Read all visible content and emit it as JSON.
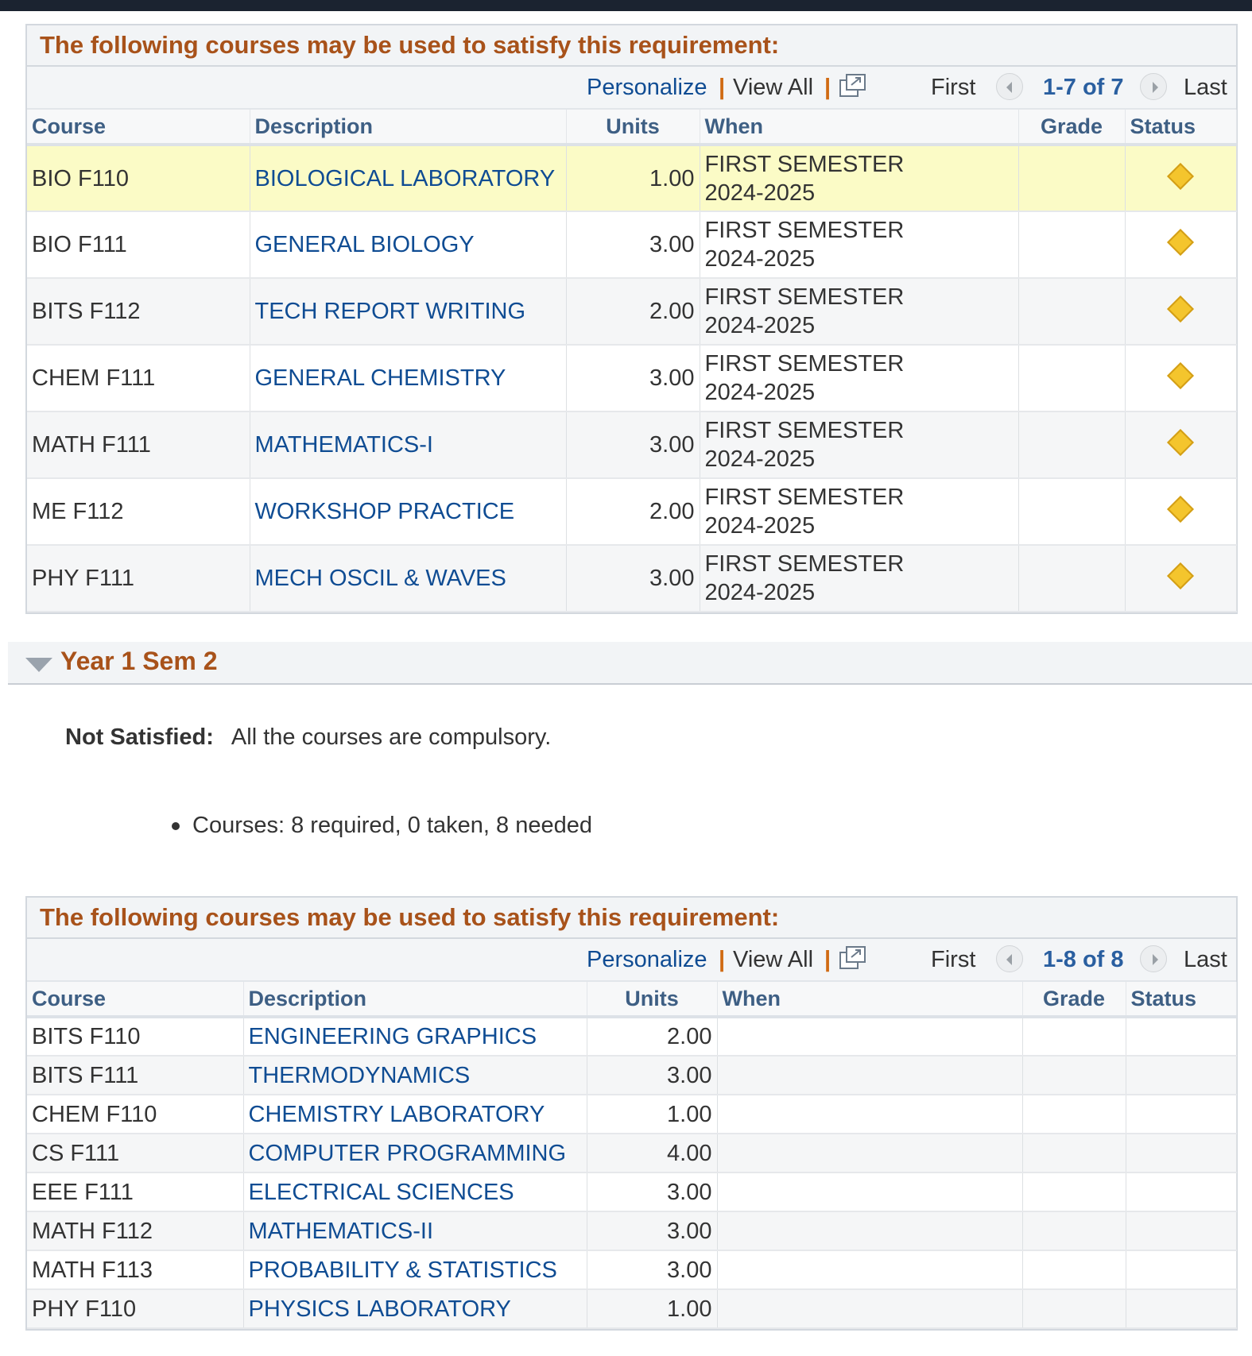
{
  "grid1": {
    "title": "The following courses may be used to satisfy this requirement:",
    "nav": {
      "personalize": "Personalize",
      "separator": "|",
      "view_all": "View All",
      "first": "First",
      "count": "1-7 of 7",
      "last": "Last",
      "popout_icon": "popout-window-icon",
      "prev_icon": "arrow-left-icon",
      "next_icon": "arrow-right-icon"
    },
    "headers": {
      "course": "Course",
      "description": "Description",
      "units": "Units",
      "when": "When",
      "grade": "Grade",
      "status": "Status"
    },
    "rows": [
      {
        "course": "BIO F110",
        "description": "BIOLOGICAL LABORATORY",
        "units": "1.00",
        "when_1": "FIRST SEMESTER",
        "when_2": "2024-2025",
        "grade": "",
        "status_icon": "in-progress-diamond-icon"
      },
      {
        "course": "BIO F111",
        "description": "GENERAL BIOLOGY",
        "units": "3.00",
        "when_1": "FIRST SEMESTER",
        "when_2": "2024-2025",
        "grade": "",
        "status_icon": "in-progress-diamond-icon"
      },
      {
        "course": "BITS F112",
        "description": "TECH REPORT WRITING",
        "units": "2.00",
        "when_1": "FIRST SEMESTER",
        "when_2": "2024-2025",
        "grade": "",
        "status_icon": "in-progress-diamond-icon"
      },
      {
        "course": "CHEM F111",
        "description": "GENERAL CHEMISTRY",
        "units": "3.00",
        "when_1": "FIRST SEMESTER",
        "when_2": "2024-2025",
        "grade": "",
        "status_icon": "in-progress-diamond-icon"
      },
      {
        "course": "MATH F111",
        "description": "MATHEMATICS-I",
        "units": "3.00",
        "when_1": "FIRST SEMESTER",
        "when_2": "2024-2025",
        "grade": "",
        "status_icon": "in-progress-diamond-icon"
      },
      {
        "course": "ME F112",
        "description": "WORKSHOP PRACTICE",
        "units": "2.00",
        "when_1": "FIRST SEMESTER",
        "when_2": "2024-2025",
        "grade": "",
        "status_icon": "in-progress-diamond-icon"
      },
      {
        "course": "PHY F111",
        "description": "MECH OSCIL & WAVES",
        "units": "3.00",
        "when_1": "FIRST SEMESTER",
        "when_2": "2024-2025",
        "grade": "",
        "status_icon": "in-progress-diamond-icon"
      }
    ]
  },
  "section": {
    "title": "Year 1 Sem 2",
    "collapse_icon": "triangle-down-icon",
    "status_label": "Not Satisfied:",
    "status_text": "All the courses are compulsory.",
    "bullet": "Courses: 8 required, 0 taken, 8 needed"
  },
  "grid2": {
    "title": "The following courses may be used to satisfy this requirement:",
    "nav": {
      "personalize": "Personalize",
      "separator": "|",
      "view_all": "View All",
      "first": "First",
      "count": "1-8 of 8",
      "last": "Last",
      "popout_icon": "popout-window-icon",
      "prev_icon": "arrow-left-icon",
      "next_icon": "arrow-right-icon"
    },
    "headers": {
      "course": "Course",
      "description": "Description",
      "units": "Units",
      "when": "When",
      "grade": "Grade",
      "status": "Status"
    },
    "rows": [
      {
        "course": "BITS F110",
        "description": "ENGINEERING GRAPHICS",
        "units": "2.00"
      },
      {
        "course": "BITS F111",
        "description": "THERMODYNAMICS",
        "units": "3.00"
      },
      {
        "course": "CHEM F110",
        "description": "CHEMISTRY LABORATORY",
        "units": "1.00"
      },
      {
        "course": "CS F111",
        "description": "COMPUTER PROGRAMMING",
        "units": "4.00"
      },
      {
        "course": "EEE F111",
        "description": "ELECTRICAL SCIENCES",
        "units": "3.00"
      },
      {
        "course": "MATH F112",
        "description": "MATHEMATICS-II",
        "units": "3.00"
      },
      {
        "course": "MATH F113",
        "description": "PROBABILITY & STATISTICS",
        "units": "3.00"
      },
      {
        "course": "PHY F110",
        "description": "PHYSICS LABORATORY",
        "units": "1.00"
      }
    ]
  }
}
